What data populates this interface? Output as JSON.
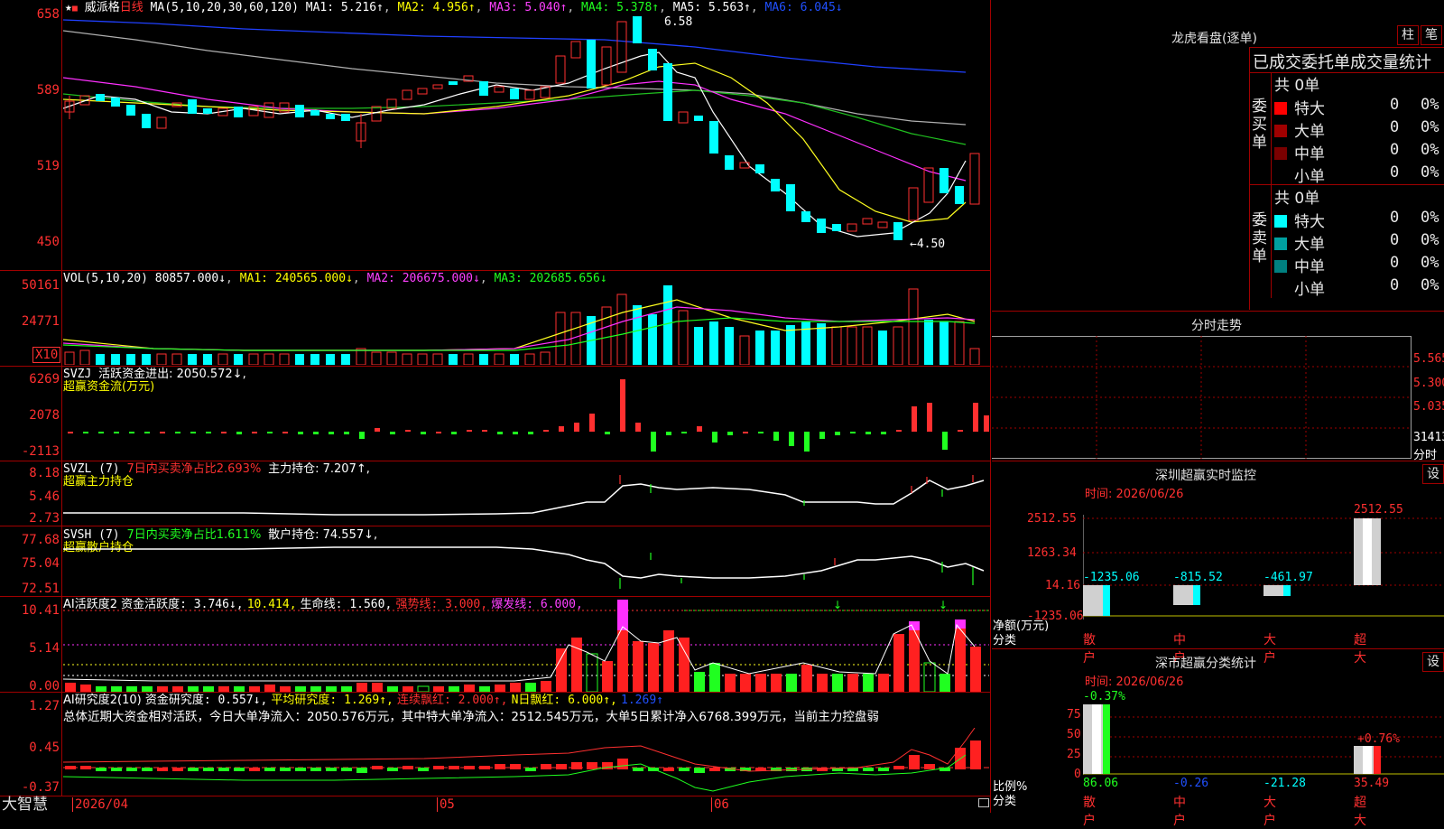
{
  "main": {
    "stock_name": "威派格",
    "period": "日线",
    "ma_header": "MA(5,10,20,30,60,120)",
    "ma1": "MA1: 5.216↑",
    "ma2": "MA2: 4.956↑",
    "ma3": "MA3: 5.040↑",
    "ma4": "MA4: 5.378↑",
    "ma5": "MA5: 5.563↑",
    "ma6": "MA6: 6.045↓",
    "high_label": "6.58",
    "low_label": "←4.50",
    "y_ticks": [
      "658",
      "589",
      "519",
      "450"
    ]
  },
  "vol": {
    "header": "VOL(5,10,20)",
    "value": "80857.000↓",
    "ma1": "MA1: 240565.000↓",
    "ma2": "MA2: 206675.000↓",
    "ma3": "MA3: 202685.656↓",
    "y_ticks": [
      "50161",
      "24771"
    ],
    "unit": "X10"
  },
  "svzj": {
    "header": "SVZJ",
    "item": "活跃资金进出: 2050.572↓,",
    "title": "超赢资金流(万元)",
    "y_ticks": [
      "6269",
      "2078",
      "-2113"
    ]
  },
  "svzl": {
    "header": "SVZL (7)",
    "ratio": "7日内买卖净占比2.693%",
    "hold": "主力持仓: 7.207↑,",
    "title": "超赢主力持仓",
    "y_ticks": [
      "8.18",
      "5.46",
      "2.73"
    ]
  },
  "svsh": {
    "header": "SVSH (7)",
    "ratio": "7日内买卖净占比1.611%",
    "hold": "散户持仓: 74.557↓,",
    "title": "超赢散户持仓",
    "y_ticks": [
      "77.68",
      "75.04",
      "72.51"
    ]
  },
  "ai_active": {
    "header": "AI活跃度2",
    "a": "资金活跃度: 3.746↓,",
    "b": "10.414,",
    "c": "生命线: 1.560,",
    "d": "强势线: 3.000,",
    "e": "爆发线: 6.000,",
    "y_ticks": [
      "10.41",
      "5.14",
      "0.00"
    ]
  },
  "ai_research": {
    "header": "AI研究度2(10)",
    "a": "资金研究度: 0.557↓,",
    "b": "平均研究度: 1.269↑,",
    "c": "连续飘红: 2.000↑,",
    "d": "N日飘红: 6.000↑,",
    "e": "1.269↑",
    "summary": "总体近期大资金相对活跃，今日大单净流入：2050.576万元，其中特大单净流入：2512.545万元，大单5日累计净入6768.399万元，当前主力控盘弱",
    "y_ticks": [
      "1.27",
      "0.45",
      "-0.37"
    ]
  },
  "bottom_axis": {
    "brand": "大智慧",
    "dates": [
      "2026/04",
      "05",
      "06"
    ]
  },
  "right": {
    "title": "龙虎看盘(逐单)",
    "btn_zhu": "柱",
    "btn_bi": "笔",
    "stat_header": "已成交委托单成交量统计",
    "buy_side_label": "委买单",
    "sell_side_label": "委卖单",
    "buy_total": "共 0单",
    "sell_total": "共 0单",
    "buy_rows": [
      {
        "name": "特大",
        "vol": "0",
        "pct": "0%"
      },
      {
        "name": "大单",
        "vol": "0",
        "pct": "0%"
      },
      {
        "name": "中单",
        "vol": "0",
        "pct": "0%"
      },
      {
        "name": "小单",
        "vol": "0",
        "pct": "0%"
      }
    ],
    "sell_rows": [
      {
        "name": "特大",
        "vol": "0",
        "pct": "0%"
      },
      {
        "name": "大单",
        "vol": "0",
        "pct": "0%"
      },
      {
        "name": "中单",
        "vol": "0",
        "pct": "0%"
      },
      {
        "name": "小单",
        "vol": "0",
        "pct": "0%"
      }
    ],
    "colors": {
      "buy": [
        "#ff0000",
        "#a00000",
        "#7a0000"
      ],
      "sell": [
        "#00ffff",
        "#00a0a0",
        "#008080"
      ]
    },
    "fenshi_title": "分时走势",
    "fenshi_ticks": [
      "5.565",
      "5.300",
      "5.035",
      "31413"
    ],
    "fenshi_unit": "分时",
    "sz_monitor_title": "深圳超赢实时监控",
    "sz_monitor_time": "时间: 2026/06/26",
    "sz_monitor_set": "设",
    "sz_monitor_y": [
      "2512.55",
      "1263.34",
      "14.16",
      "-1235.06"
    ],
    "sz_monitor_ylabel": "净额(万元)",
    "sz_monitor_xlabel": "分类",
    "sz_monitor_cats": [
      "散户",
      "中户",
      "大户",
      "超大"
    ],
    "sz_monitor_vals": [
      "-1235.06",
      "-815.52",
      "-461.97",
      "2512.55"
    ],
    "sc_stat_title": "深市超赢分类统计",
    "sc_stat_time": "时间: 2026/06/26",
    "sc_stat_set": "设",
    "sc_stat_y": [
      "75",
      "50",
      "25",
      "0"
    ],
    "sc_stat_ylabel": "比例%",
    "sc_stat_xlabel": "分类",
    "sc_stat_cats": [
      "散户",
      "中户",
      "大户",
      "超大"
    ],
    "sc_stat_bottom": [
      "86.06",
      "-0.26",
      "-21.28",
      "35.49"
    ],
    "sc_stat_top": [
      "-0.37%",
      "+0.76%"
    ]
  }
}
